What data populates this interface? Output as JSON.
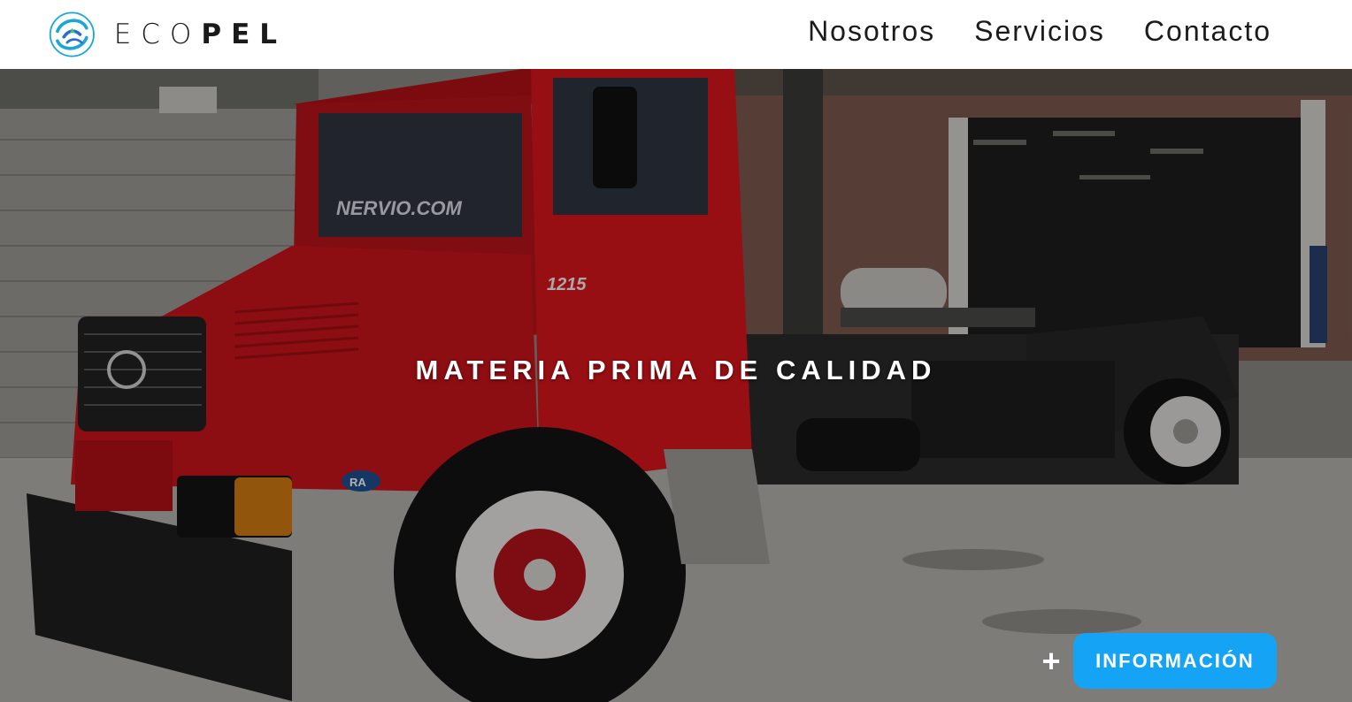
{
  "header": {
    "brand": {
      "light": "ECO",
      "bold": "PEL"
    },
    "nav": [
      {
        "label": "Nosotros"
      },
      {
        "label": "Servicios"
      },
      {
        "label": "Contacto"
      }
    ]
  },
  "hero": {
    "headline": "MATERIA PRIMA DE CALIDAD",
    "cta": {
      "icon": "plus-icon",
      "label": "INFORMACIÓN"
    },
    "truck_text": {
      "windshield": "NERVIO.COM",
      "model": "1215",
      "badge": "RA"
    }
  },
  "colors": {
    "accent": "#14a3f5",
    "truck": "#d8151c",
    "nav_text": "#1b1b1b"
  }
}
